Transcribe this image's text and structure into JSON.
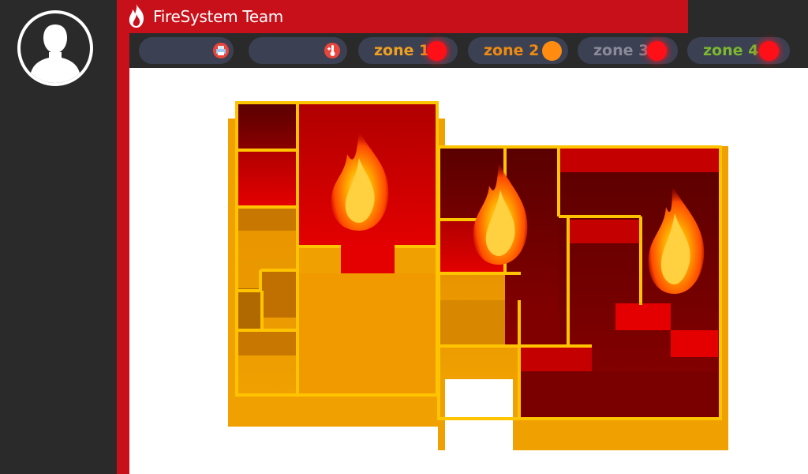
{
  "app": {
    "title": "FireSystem Team"
  },
  "toolbar": {
    "sensor_buttons": [
      {
        "icon": "printer-icon"
      },
      {
        "icon": "thermometer-icon"
      }
    ],
    "zones": [
      {
        "label": "zone 1",
        "label_color": "#f0a020",
        "status_color": "#ff0f18"
      },
      {
        "label": "zone 2",
        "label_color": "#f08a10",
        "status_color": "#ff8c10"
      },
      {
        "label": "zone 3",
        "label_color": "#8a8a9a",
        "status_color": "#ff0f18"
      },
      {
        "label": "zone 4",
        "label_color": "#7cb830",
        "status_color": "#ff0f18"
      }
    ]
  },
  "colors": {
    "brand_red": "#c8101a",
    "sidebar": "#2a2a2a",
    "pill": "#3b4152"
  },
  "floorplan": {
    "rooms_on_fire": 3
  }
}
